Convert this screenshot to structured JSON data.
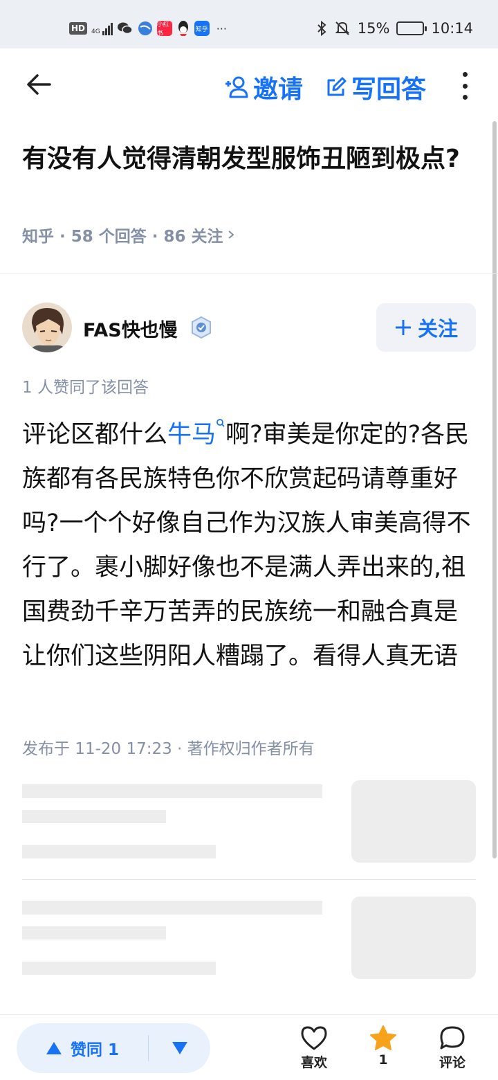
{
  "status_bar": {
    "hd": "HD",
    "network": "4G",
    "app_xiaohongshu": "小红书",
    "app_zhihu": "知乎",
    "more": "···",
    "battery": "15%",
    "battery_level": 0.15,
    "time": "10:14"
  },
  "nav": {
    "invite_label": "邀请",
    "write_answer_label": "写回答"
  },
  "question": {
    "title": "有没有人觉得清朝发型服饰丑陋到极点?",
    "meta": "知乎 · 58 个回答 · 86 关注"
  },
  "answer": {
    "author_name": "FAS快也慢",
    "follow_label": "关注",
    "vote_note": "1 人赞同了该回答",
    "content_before_link": "评论区都什么",
    "content_link": "牛马",
    "content_after_link": "啊?审美是你定的?各民族都有各民族特色你不欣赏起码请尊重好吗?一个个好像自己作为汉族人审美高得不行了。裹小脚好像也不是满人弄出来的,祖国费劲千辛万苦弄的民族统一和融合真是让你们这些阴阳人糟蹋了。看得人真无语",
    "publish_info": "发布于 11-20 17:23 · 著作权归作者所有"
  },
  "bottom_bar": {
    "upvote_label": "赞同 1",
    "like_label": "喜欢",
    "favorite_count": "1",
    "comment_label": "评论"
  },
  "colors": {
    "accent": "#1772f6",
    "muted": "#8590a6",
    "star": "#f7a21b"
  }
}
